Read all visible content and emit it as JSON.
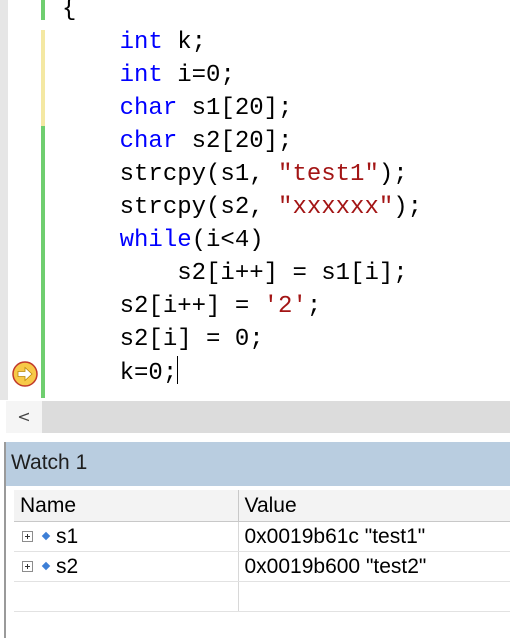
{
  "editor": {
    "code_lines": [
      [
        {
          "t": "{",
          "c": "plain"
        }
      ],
      [
        {
          "t": "    ",
          "c": "plain"
        },
        {
          "t": "int",
          "c": "kw"
        },
        {
          "t": " k;",
          "c": "plain"
        }
      ],
      [
        {
          "t": "    ",
          "c": "plain"
        },
        {
          "t": "int",
          "c": "kw"
        },
        {
          "t": " i=0;",
          "c": "plain"
        }
      ],
      [
        {
          "t": "    ",
          "c": "plain"
        },
        {
          "t": "char",
          "c": "kw"
        },
        {
          "t": " s1[20];",
          "c": "plain"
        }
      ],
      [
        {
          "t": "    ",
          "c": "plain"
        },
        {
          "t": "char",
          "c": "kw"
        },
        {
          "t": " s2[20];",
          "c": "plain"
        }
      ],
      [
        {
          "t": "    strcpy(s1, ",
          "c": "plain"
        },
        {
          "t": "\"test1\"",
          "c": "str"
        },
        {
          "t": ");",
          "c": "plain"
        }
      ],
      [
        {
          "t": "    strcpy(s2, ",
          "c": "plain"
        },
        {
          "t": "\"xxxxxx\"",
          "c": "str"
        },
        {
          "t": ");",
          "c": "plain"
        }
      ],
      [
        {
          "t": "    ",
          "c": "plain"
        },
        {
          "t": "while",
          "c": "kw"
        },
        {
          "t": "(i<4)",
          "c": "plain"
        }
      ],
      [
        {
          "t": "        s2[i++] = s1[i];",
          "c": "plain"
        }
      ],
      [
        {
          "t": "    s2[i++] = ",
          "c": "plain"
        },
        {
          "t": "'2'",
          "c": "str"
        },
        {
          "t": ";",
          "c": "plain"
        }
      ],
      [
        {
          "t": "    s2[i] = 0;",
          "c": "plain"
        }
      ],
      [
        {
          "t": "    k=0;",
          "c": "plain"
        }
      ]
    ],
    "current_line_index": 11,
    "change_bar_colors": [
      "#f4e8a3",
      "#6fce6f"
    ]
  },
  "scrollbar": {
    "left_arrow": "<"
  },
  "watch": {
    "title": "Watch 1",
    "columns": [
      "Name",
      "Value"
    ],
    "rows": [
      {
        "name": "s1",
        "value": "0x0019b61c \"test1\""
      },
      {
        "name": "s2",
        "value": "0x0019b600 \"test2\""
      }
    ]
  },
  "icons": {
    "current_statement": "yellow-arrow-icon",
    "expand": "plus-box-icon",
    "variable": "blue-diamond-icon"
  }
}
